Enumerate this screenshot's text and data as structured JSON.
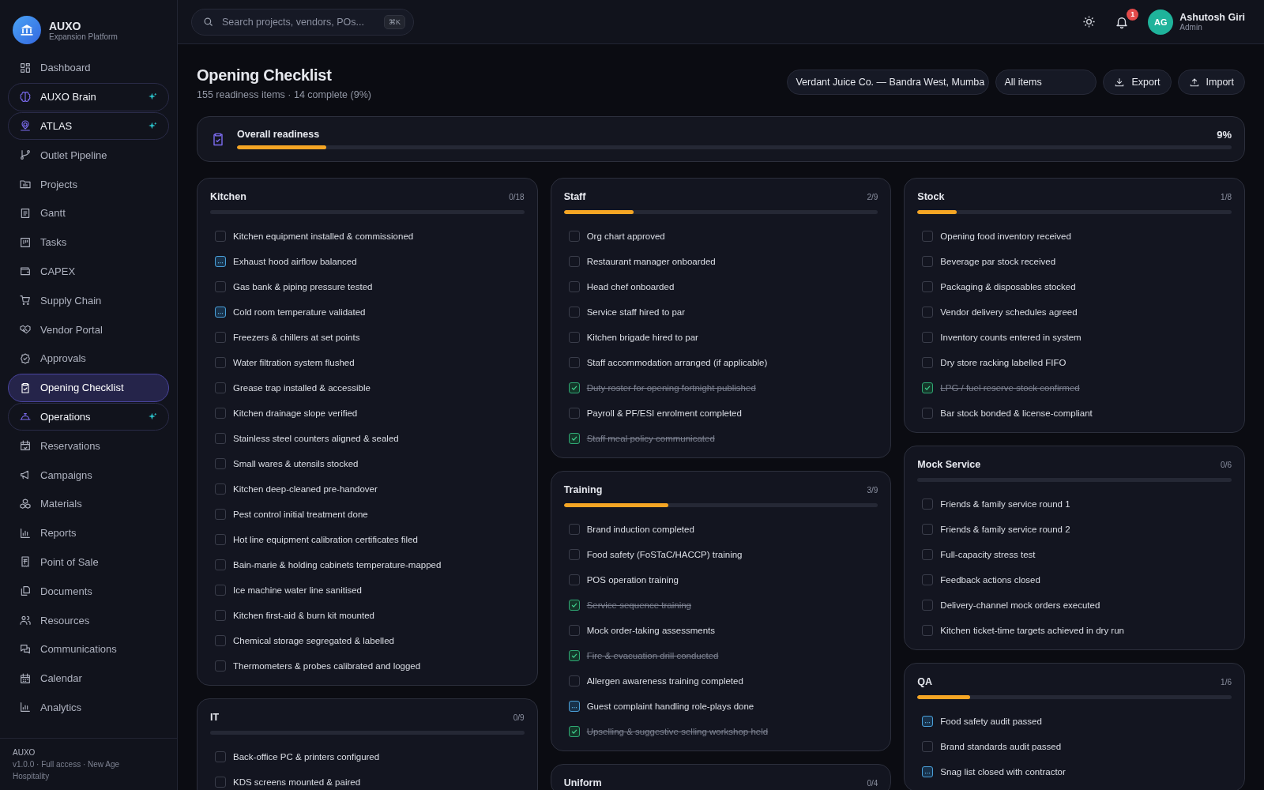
{
  "brand": {
    "name": "AUXO",
    "tagline": "Expansion Platform"
  },
  "sidebar": {
    "items": [
      {
        "label": "Dashboard",
        "selected": false,
        "featured": false
      },
      {
        "label": "AUXO Brain",
        "selected": false,
        "featured": true
      },
      {
        "label": "ATLAS",
        "selected": false,
        "featured": true
      },
      {
        "label": "Outlet Pipeline",
        "selected": false,
        "featured": false
      },
      {
        "label": "Projects",
        "selected": false,
        "featured": false
      },
      {
        "label": "Gantt",
        "selected": false,
        "featured": false
      },
      {
        "label": "Tasks",
        "selected": false,
        "featured": false
      },
      {
        "label": "CAPEX",
        "selected": false,
        "featured": false
      },
      {
        "label": "Supply Chain",
        "selected": false,
        "featured": false
      },
      {
        "label": "Vendor Portal",
        "selected": false,
        "featured": false
      },
      {
        "label": "Approvals",
        "selected": false,
        "featured": false
      },
      {
        "label": "Opening Checklist",
        "selected": true,
        "featured": false
      },
      {
        "label": "Operations",
        "selected": false,
        "featured": true
      },
      {
        "label": "Reservations",
        "selected": false,
        "featured": false
      },
      {
        "label": "Campaigns",
        "selected": false,
        "featured": false
      },
      {
        "label": "Materials",
        "selected": false,
        "featured": false
      },
      {
        "label": "Reports",
        "selected": false,
        "featured": false
      },
      {
        "label": "Point of Sale",
        "selected": false,
        "featured": false
      },
      {
        "label": "Documents",
        "selected": false,
        "featured": false
      },
      {
        "label": "Resources",
        "selected": false,
        "featured": false
      },
      {
        "label": "Communications",
        "selected": false,
        "featured": false
      },
      {
        "label": "Calendar",
        "selected": false,
        "featured": false
      },
      {
        "label": "Analytics",
        "selected": false,
        "featured": false
      }
    ],
    "footer": {
      "title": "AUXO",
      "text": "v1.0.0 · Full access · New Age Hospitality"
    }
  },
  "topbar": {
    "search": {
      "placeholder": "Search projects, vendors, POs...",
      "shortcut": "⌘K"
    },
    "notifications": "1",
    "user": {
      "initials": "AG",
      "name": "Ashutosh Giri",
      "role": "Admin"
    }
  },
  "page": {
    "title": "Opening Checklist",
    "subtitle": "155 readiness items · 14 complete (9%)",
    "outlet": "Verdant Juice Co. — Bandra West, Mumba",
    "filter": "All items",
    "buttons": [
      "Export",
      "Import"
    ]
  },
  "overall": {
    "label": "Overall readiness",
    "level": 0.09,
    "percent": "9%"
  },
  "columns": [
    {
      "sections": [
        {
          "title": "Kitchen",
          "count": "0/18",
          "level": 0,
          "items": [
            {
              "label": "Kitchen equipment installed & commissioned",
              "checked": false,
              "in_progress": false
            },
            {
              "label": "Exhaust hood airflow balanced",
              "checked": false,
              "in_progress": true
            },
            {
              "label": "Gas bank & piping pressure tested",
              "checked": false,
              "in_progress": false
            },
            {
              "label": "Cold room temperature validated",
              "checked": false,
              "in_progress": true
            },
            {
              "label": "Freezers & chillers at set points",
              "checked": false,
              "in_progress": false
            },
            {
              "label": "Water filtration system flushed",
              "checked": false,
              "in_progress": false
            },
            {
              "label": "Grease trap installed & accessible",
              "checked": false,
              "in_progress": false
            },
            {
              "label": "Kitchen drainage slope verified",
              "checked": false,
              "in_progress": false
            },
            {
              "label": "Stainless steel counters aligned & sealed",
              "checked": false,
              "in_progress": false
            },
            {
              "label": "Small wares & utensils stocked",
              "checked": false,
              "in_progress": false
            },
            {
              "label": "Kitchen deep-cleaned pre-handover",
              "checked": false,
              "in_progress": false
            },
            {
              "label": "Pest control initial treatment done",
              "checked": false,
              "in_progress": false
            },
            {
              "label": "Hot line equipment calibration certificates filed",
              "checked": false,
              "in_progress": false
            },
            {
              "label": "Bain-marie & holding cabinets temperature-mapped",
              "checked": false,
              "in_progress": false
            },
            {
              "label": "Ice machine water line sanitised",
              "checked": false,
              "in_progress": false
            },
            {
              "label": "Kitchen first-aid & burn kit mounted",
              "checked": false,
              "in_progress": false
            },
            {
              "label": "Chemical storage segregated & labelled",
              "checked": false,
              "in_progress": false
            },
            {
              "label": "Thermometers & probes calibrated and logged",
              "checked": false,
              "in_progress": false
            }
          ]
        },
        {
          "title": "IT",
          "count": "0/9",
          "level": 0,
          "items": [
            {
              "label": "Back-office PC & printers configured",
              "checked": false,
              "in_progress": false
            },
            {
              "label": "KDS screens mounted & paired",
              "checked": false,
              "in_progress": false
            }
          ]
        }
      ]
    },
    {
      "sections": [
        {
          "title": "Staff",
          "count": "2/9",
          "level": 0.222,
          "items": [
            {
              "label": "Org chart approved",
              "checked": false,
              "in_progress": false
            },
            {
              "label": "Restaurant manager onboarded",
              "checked": false,
              "in_progress": false
            },
            {
              "label": "Head chef onboarded",
              "checked": false,
              "in_progress": false
            },
            {
              "label": "Service staff hired to par",
              "checked": false,
              "in_progress": false
            },
            {
              "label": "Kitchen brigade hired to par",
              "checked": false,
              "in_progress": false
            },
            {
              "label": "Staff accommodation arranged (if applicable)",
              "checked": false,
              "in_progress": false
            },
            {
              "label": "Duty roster for opening fortnight published",
              "checked": true,
              "in_progress": false
            },
            {
              "label": "Payroll & PF/ESI enrolment completed",
              "checked": false,
              "in_progress": false
            },
            {
              "label": "Staff meal policy communicated",
              "checked": true,
              "in_progress": false
            }
          ]
        },
        {
          "title": "Training",
          "count": "3/9",
          "level": 0.333,
          "items": [
            {
              "label": "Brand induction completed",
              "checked": false,
              "in_progress": false
            },
            {
              "label": "Food safety (FoSTaC/HACCP) training",
              "checked": false,
              "in_progress": false
            },
            {
              "label": "POS operation training",
              "checked": false,
              "in_progress": false
            },
            {
              "label": "Service sequence training",
              "checked": true,
              "in_progress": false
            },
            {
              "label": "Mock order-taking assessments",
              "checked": false,
              "in_progress": false
            },
            {
              "label": "Fire & evacuation drill conducted",
              "checked": true,
              "in_progress": false
            },
            {
              "label": "Allergen awareness training completed",
              "checked": false,
              "in_progress": false
            },
            {
              "label": "Guest complaint handling role-plays done",
              "checked": false,
              "in_progress": true
            },
            {
              "label": "Upselling & suggestive selling workshop held",
              "checked": true,
              "in_progress": false
            }
          ]
        },
        {
          "title": "Uniform",
          "count": "0/4"
        }
      ]
    },
    {
      "sections": [
        {
          "title": "Stock",
          "count": "1/8",
          "level": 0.125,
          "items": [
            {
              "label": "Opening food inventory received",
              "checked": false,
              "in_progress": false
            },
            {
              "label": "Beverage par stock received",
              "checked": false,
              "in_progress": false
            },
            {
              "label": "Packaging & disposables stocked",
              "checked": false,
              "in_progress": false
            },
            {
              "label": "Vendor delivery schedules agreed",
              "checked": false,
              "in_progress": false
            },
            {
              "label": "Inventory counts entered in system",
              "checked": false,
              "in_progress": false
            },
            {
              "label": "Dry store racking labelled FIFO",
              "checked": false,
              "in_progress": false
            },
            {
              "label": "LPG / fuel reserve stock confirmed",
              "checked": true,
              "in_progress": false
            },
            {
              "label": "Bar stock bonded & license-compliant",
              "checked": false,
              "in_progress": false
            }
          ]
        },
        {
          "title": "Mock Service",
          "count": "0/6",
          "level": 0,
          "items": [
            {
              "label": "Friends & family service round 1",
              "checked": false,
              "in_progress": false
            },
            {
              "label": "Friends & family service round 2",
              "checked": false,
              "in_progress": false
            },
            {
              "label": "Full-capacity stress test",
              "checked": false,
              "in_progress": false
            },
            {
              "label": "Feedback actions closed",
              "checked": false,
              "in_progress": false
            },
            {
              "label": "Delivery-channel mock orders executed",
              "checked": false,
              "in_progress": false
            },
            {
              "label": "Kitchen ticket-time targets achieved in dry run",
              "checked": false,
              "in_progress": false
            }
          ]
        },
        {
          "title": "QA",
          "count": "1/6",
          "level": 0.167,
          "items": [
            {
              "label": "Food safety audit passed",
              "checked": false,
              "in_progress": true
            },
            {
              "label": "Brand standards audit passed",
              "checked": false,
              "in_progress": false
            },
            {
              "label": "Snag list closed with contractor",
              "checked": false,
              "in_progress": true
            }
          ]
        }
      ]
    }
  ]
}
